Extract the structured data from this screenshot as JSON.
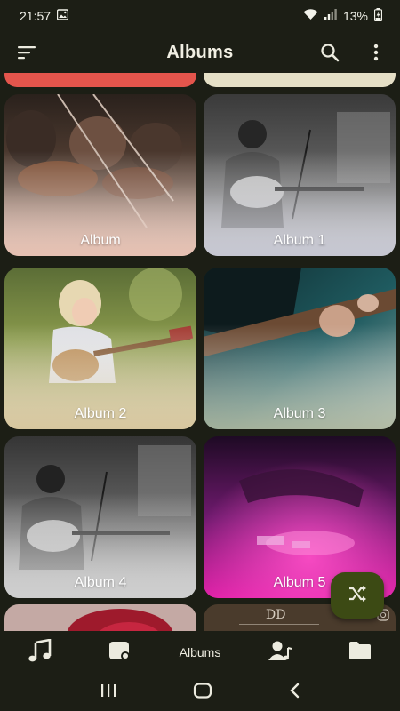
{
  "status_bar": {
    "time": "21:57",
    "battery": "13%"
  },
  "app_bar": {
    "title": "Albums"
  },
  "albums": [
    {
      "label": "Album"
    },
    {
      "label": "Album 1"
    },
    {
      "label": "Album 2"
    },
    {
      "label": "Album 3"
    },
    {
      "label": "Album 4"
    },
    {
      "label": "Album 5"
    }
  ],
  "bottom_nav": {
    "active_label": "Albums"
  },
  "colors": {
    "background": "#1c1e15",
    "fab": "#3c4a14",
    "text": "#ecebdf"
  },
  "icons": [
    "gallery-icon",
    "wifi-icon",
    "signal-icon",
    "battery-icon",
    "sort-icon",
    "search-icon",
    "more-vert-icon",
    "shuffle-icon",
    "music-note-icon",
    "album-icon",
    "artist-icon",
    "folder-icon",
    "recents-icon",
    "home-icon",
    "back-icon"
  ]
}
